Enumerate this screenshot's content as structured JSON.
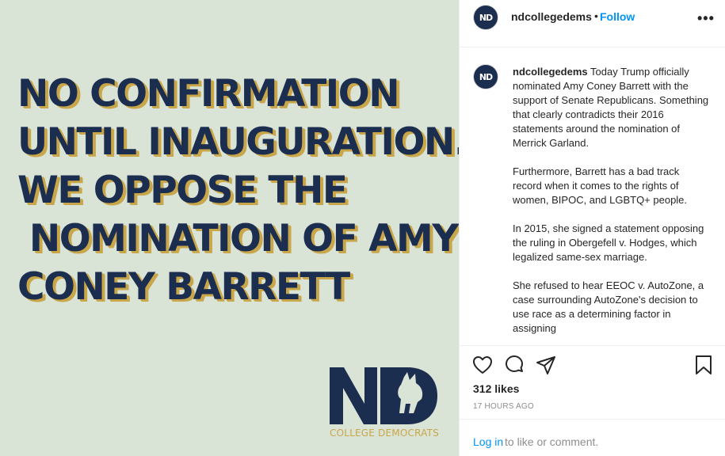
{
  "post_image": {
    "headline_lines": [
      "NO CONFIRMATION",
      "UNTIL INAUGURATION.",
      "WE OPPOSE THE",
      " NOMINATION OF AMY",
      "CONEY BARRETT"
    ],
    "logo_text": "ND",
    "logo_caption": "COLLEGE DEMOCRATS",
    "colors": {
      "background": "#d9e4d7",
      "navy": "#1c2e4f",
      "gold": "#c9a64a"
    }
  },
  "header": {
    "username": "ndcollegedems",
    "separator": "•",
    "follow_label": "Follow",
    "more_label": "•••",
    "avatar_text": "ND"
  },
  "caption": {
    "username": "ndcollegedems",
    "paragraphs": [
      "Today Trump officially nominated Amy Coney Barrett with the support of Senate Republicans. Something that clearly contradicts their 2016 statements around the nomination of Merrick Garland.",
      "Furthermore, Barrett has a bad track record when it comes to the rights of women, BIPOC, and LGBTQ+ people.",
      "In 2015, she signed a statement opposing the ruling in Obergefell v. Hodges, which legalized same-sex marriage.",
      "She refused to hear EEOC v. AutoZone, a case surrounding AutoZone's decision to use race as a determining factor in assigning"
    ]
  },
  "actions": {
    "icons": [
      "heart-icon",
      "comment-icon",
      "share-icon",
      "bookmark-icon"
    ],
    "likes": "312 likes",
    "timestamp": "17 HOURS AGO"
  },
  "footer": {
    "login_label": "Log in",
    "login_suffix": "to like or comment."
  },
  "colors": {
    "link_blue": "#0095f6",
    "text": "#262626",
    "muted": "#8e8e8e"
  }
}
